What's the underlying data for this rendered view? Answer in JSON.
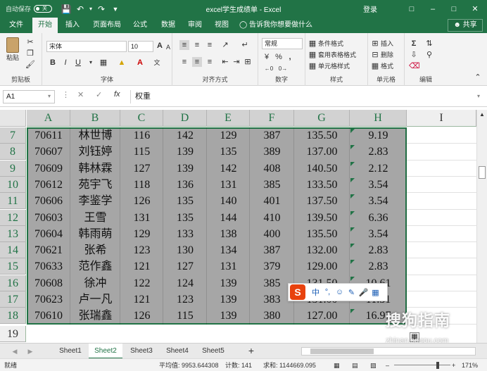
{
  "titlebar": {
    "autosave_label": "自动保存",
    "autosave_state": "关",
    "title": "excel学生成绩单  -  Excel",
    "login": "登录",
    "icons": [
      "save-icon",
      "undo-icon",
      "redo-icon",
      "qat-customize-icon",
      "restore-ribbon-icon",
      "minimize-icon",
      "maximize-icon",
      "close-icon"
    ]
  },
  "tabs": {
    "items": [
      "文件",
      "开始",
      "插入",
      "页面布局",
      "公式",
      "数据",
      "审阅",
      "视图"
    ],
    "active": "开始",
    "tell_me": "告诉我你想要做什么",
    "share": "共享"
  },
  "ribbon": {
    "clipboard": {
      "paste": "粘贴",
      "label": "剪贴板"
    },
    "font": {
      "name": "宋体",
      "size": "10",
      "bold": "B",
      "italic": "I",
      "underline": "U",
      "label": "字体"
    },
    "alignment": {
      "label": "对齐方式"
    },
    "number": {
      "format": "常规",
      "currency": "%",
      "comma": ",",
      "label": "数字"
    },
    "styles": {
      "conditional": "条件格式",
      "table": "套用表格格式",
      "cell": "单元格样式",
      "label": "样式"
    },
    "cells": {
      "insert": "插入",
      "delete": "删除",
      "format": "格式",
      "label": "单元格"
    },
    "editing": {
      "label": "编辑"
    }
  },
  "formula_bar": {
    "name_box": "A1",
    "formula": "权重"
  },
  "columns": [
    "A",
    "B",
    "C",
    "D",
    "E",
    "F",
    "G",
    "H",
    "I"
  ],
  "rows": [
    {
      "num": "7",
      "a": "70611",
      "b": "林世博",
      "c": "116",
      "d": "142",
      "e": "129",
      "f": "387",
      "g": "135.50",
      "h": "9.19"
    },
    {
      "num": "8",
      "a": "70607",
      "b": "刘钰婷",
      "c": "115",
      "d": "139",
      "e": "135",
      "f": "389",
      "g": "137.00",
      "h": "2.83"
    },
    {
      "num": "9",
      "a": "70609",
      "b": "韩林霖",
      "c": "127",
      "d": "139",
      "e": "142",
      "f": "408",
      "g": "140.50",
      "h": "2.12"
    },
    {
      "num": "10",
      "a": "70612",
      "b": "苑宇飞",
      "c": "118",
      "d": "136",
      "e": "131",
      "f": "385",
      "g": "133.50",
      "h": "3.54"
    },
    {
      "num": "11",
      "a": "70606",
      "b": "李鉴学",
      "c": "126",
      "d": "135",
      "e": "140",
      "f": "401",
      "g": "137.50",
      "h": "3.54"
    },
    {
      "num": "12",
      "a": "70603",
      "b": "王雪",
      "c": "131",
      "d": "135",
      "e": "144",
      "f": "410",
      "g": "139.50",
      "h": "6.36"
    },
    {
      "num": "13",
      "a": "70604",
      "b": "韩雨萌",
      "c": "129",
      "d": "133",
      "e": "138",
      "f": "400",
      "g": "135.50",
      "h": "3.54"
    },
    {
      "num": "14",
      "a": "70621",
      "b": "张希",
      "c": "123",
      "d": "130",
      "e": "134",
      "f": "387",
      "g": "132.00",
      "h": "2.83"
    },
    {
      "num": "15",
      "a": "70633",
      "b": "范作鑫",
      "c": "121",
      "d": "127",
      "e": "131",
      "f": "379",
      "g": "129.00",
      "h": "2.83"
    },
    {
      "num": "16",
      "a": "70608",
      "b": "徐冲",
      "c": "122",
      "d": "124",
      "e": "139",
      "f": "385",
      "g": "131.50",
      "h": "10.61"
    },
    {
      "num": "17",
      "a": "70623",
      "b": "卢一凡",
      "c": "121",
      "d": "123",
      "e": "139",
      "f": "383",
      "g": "131.00",
      "h": "11.31"
    },
    {
      "num": "18",
      "a": "70610",
      "b": "张瑞鑫",
      "c": "126",
      "d": "115",
      "e": "139",
      "f": "380",
      "g": "127.00",
      "h": "16.97"
    }
  ],
  "last_row_num": "19",
  "ime": {
    "logo": "S",
    "mode": "中"
  },
  "sheets": {
    "items": [
      "Sheet1",
      "Sheet2",
      "Sheet3",
      "Sheet4",
      "Sheet5"
    ],
    "active": "Sheet2",
    "add": "+"
  },
  "status": {
    "ready": "就绪",
    "average": "平均值: 9953.644308",
    "count": "计数: 141",
    "sum": "求和: 1144669.095",
    "zoom": "171%"
  },
  "watermark": {
    "text": "搜狗指南",
    "url": "zhinan.sogou.com"
  },
  "colors": {
    "accent": "#217346",
    "selection": "#a6a6a6"
  }
}
